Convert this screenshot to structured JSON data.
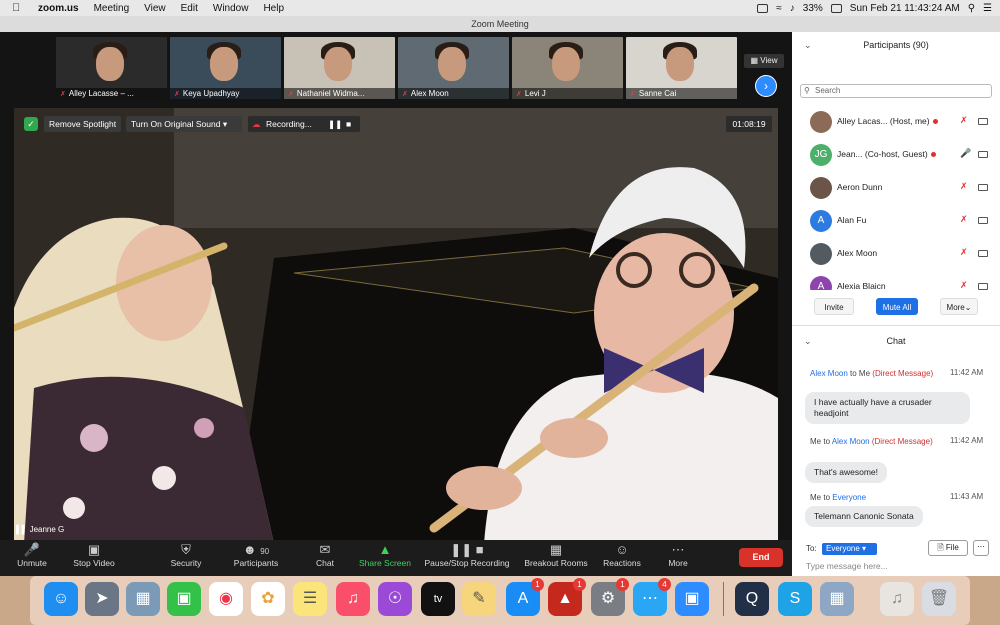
{
  "menubar": {
    "app": "zoom.us",
    "items": [
      "Meeting",
      "View",
      "Edit",
      "Window",
      "Help"
    ],
    "battery": "33%",
    "datetime": "Sun Feb 21  11:43:24 AM"
  },
  "window": {
    "title": "Zoom Meeting"
  },
  "thumbnails": [
    {
      "name": "Alley Lacasse – ...",
      "bg": "#2b2b2b"
    },
    {
      "name": "Keya Upadhyay",
      "bg": "#3a4b5a"
    },
    {
      "name": "Nathaniel Widma...",
      "bg": "#c8c2b6"
    },
    {
      "name": "Alex Moon",
      "bg": "#5f6a72"
    },
    {
      "name": "Levi J",
      "bg": "#8a8578"
    },
    {
      "name": "Sanne Cai",
      "bg": "#d8d5cf"
    }
  ],
  "view_label": "View",
  "spotlight": {
    "remove": "Remove Spotlight",
    "original_sound": "Turn On Original Sound",
    "recording": "Recording...",
    "timer": "01:08:19",
    "speaker": "Jeanne G"
  },
  "toolbar": {
    "unmute": "Unmute",
    "stop_video": "Stop Video",
    "security": "Security",
    "participants": "Participants",
    "participants_count": "90",
    "chat": "Chat",
    "share_screen": "Share Screen",
    "pause_recording": "Pause/Stop Recording",
    "breakout": "Breakout Rooms",
    "reactions": "Reactions",
    "more": "More",
    "end": "End"
  },
  "participants_panel": {
    "title": "Participants (90)",
    "search_placeholder": "Search",
    "rows": [
      {
        "name": "Alley Lacas...   (Host, me)",
        "initials": "",
        "avatar_color": "#8b6a58",
        "mic_muted": true,
        "recording": true
      },
      {
        "name": "Jean...   (Co-host, Guest)",
        "initials": "JG",
        "avatar_color": "#4caf6a",
        "mic_muted": false,
        "recording": true
      },
      {
        "name": "Aeron Dunn",
        "initials": "",
        "avatar_color": "#6b5548",
        "mic_muted": true,
        "recording": false
      },
      {
        "name": "Alan Fu",
        "initials": "A",
        "avatar_color": "#2d7be0",
        "mic_muted": true,
        "recording": false
      },
      {
        "name": "Alex Moon",
        "initials": "",
        "avatar_color": "#545b60",
        "mic_muted": true,
        "recording": false
      },
      {
        "name": "Alexia Blaicn",
        "initials": "A",
        "avatar_color": "#8e44ad",
        "mic_muted": true,
        "recording": false
      }
    ],
    "invite": "Invite",
    "mute_all": "Mute All",
    "more": "More"
  },
  "chat_panel": {
    "title": "Chat",
    "messages": [
      {
        "from": "Alex Moon",
        "to": "Me",
        "tag": "(Direct Message)",
        "time": "11:42 AM",
        "text": "I have actually have a crusader headjoint"
      },
      {
        "from": "Me",
        "to": "Alex Moon",
        "tag": "(Direct Message)",
        "time": "11:42 AM",
        "text": "That's awesome!"
      },
      {
        "from": "Me",
        "to": "Everyone",
        "tag": "",
        "time": "11:43 AM",
        "text": "Telemann Canonic Sonata"
      }
    ],
    "to_label": "To:",
    "to_value": "Everyone",
    "file": "File",
    "placeholder": "Type message here..."
  },
  "dock_badges": {
    "appstore": "1",
    "acrobat": "1",
    "sysprefs": "1",
    "messages": "4"
  }
}
